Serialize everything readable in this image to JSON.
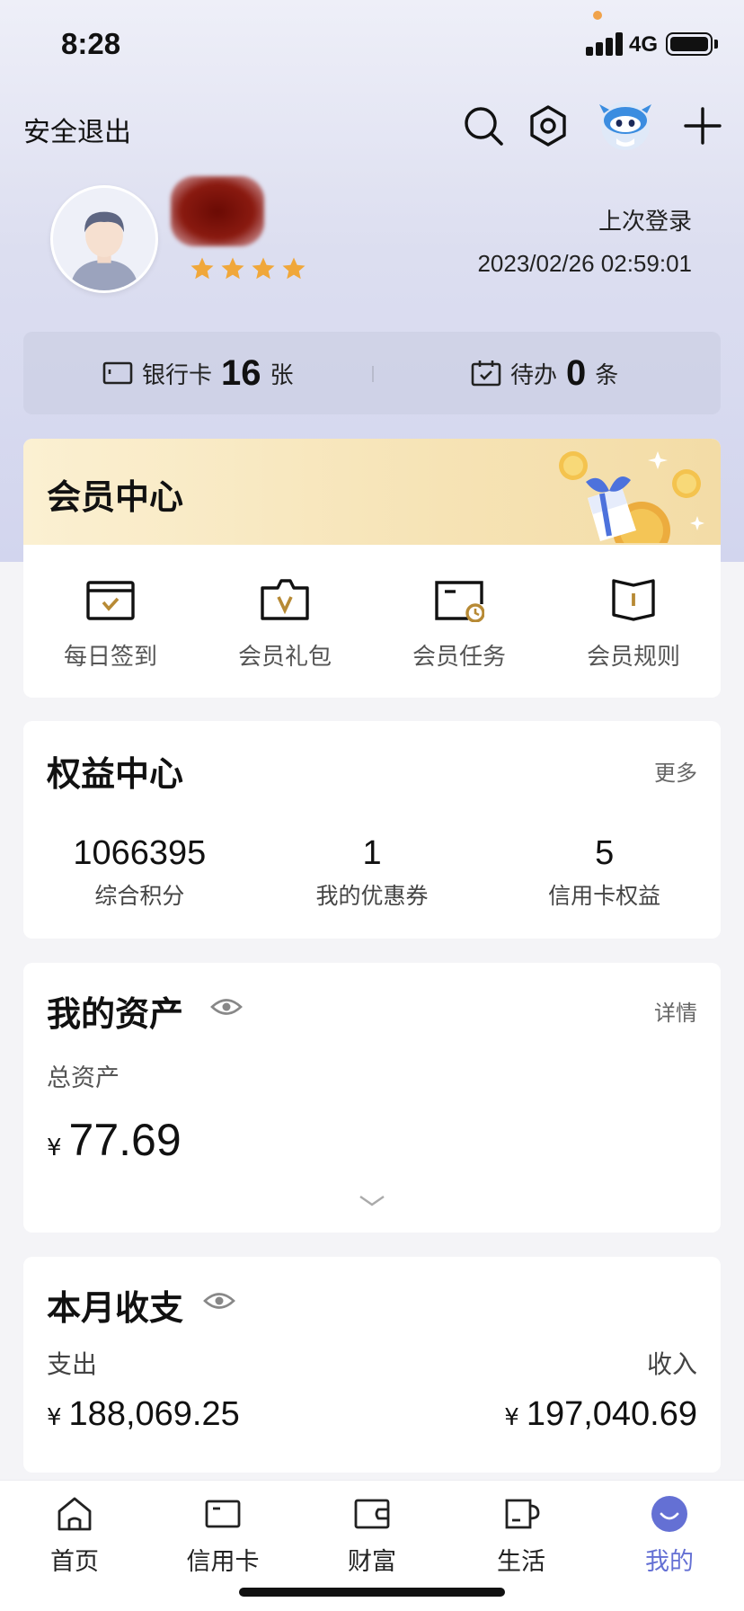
{
  "status": {
    "time": "8:28",
    "network": "4G"
  },
  "header": {
    "logout_label": "安全退出"
  },
  "profile": {
    "star_count": 4,
    "last_login_label": "上次登录",
    "last_login_time": "2023/02/26 02:59:01"
  },
  "summary": {
    "cards_label": "银行卡",
    "cards_count": "16",
    "cards_unit": "张",
    "todo_label": "待办",
    "todo_count": "0",
    "todo_unit": "条"
  },
  "member": {
    "title": "会员中心",
    "items": [
      {
        "label": "每日签到",
        "icon": "daily-checkin-icon"
      },
      {
        "label": "会员礼包",
        "icon": "gift-package-icon"
      },
      {
        "label": "会员任务",
        "icon": "member-task-icon"
      },
      {
        "label": "会员规则",
        "icon": "member-rules-icon"
      }
    ]
  },
  "rights": {
    "title": "权益中心",
    "more": "更多",
    "items": [
      {
        "value": "1066395",
        "label": "综合积分"
      },
      {
        "value": "1",
        "label": "我的优惠券"
      },
      {
        "value": "5",
        "label": "信用卡权益"
      }
    ]
  },
  "assets": {
    "title": "我的资产",
    "detail": "详情",
    "total_label": "总资产",
    "currency": "¥",
    "total": "77.69"
  },
  "monthly": {
    "title": "本月收支",
    "expense_label": "支出",
    "income_label": "收入",
    "currency": "¥",
    "expense": "188,069.25",
    "income": "197,040.69"
  },
  "tabs": [
    {
      "label": "首页",
      "icon": "home-icon"
    },
    {
      "label": "信用卡",
      "icon": "credit-card-icon"
    },
    {
      "label": "财富",
      "icon": "wallet-icon"
    },
    {
      "label": "生活",
      "icon": "cup-icon"
    },
    {
      "label": "我的",
      "icon": "mine-icon",
      "active": true
    }
  ],
  "colors": {
    "accent": "#6470d4",
    "gold": "#b78a35",
    "star": "#f0a73a"
  }
}
